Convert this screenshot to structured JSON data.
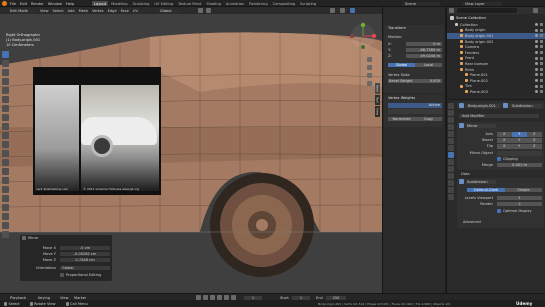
{
  "menubar": {
    "menus": [
      "File",
      "Edit",
      "Render",
      "Window",
      "Help"
    ],
    "workspaces": [
      "Layout",
      "Modeling",
      "Sculpting",
      "UV Editing",
      "Texture Paint",
      "Shading",
      "Animation",
      "Rendering",
      "Compositing",
      "Scripting"
    ],
    "scene": "Scene",
    "view_layer": "View Layer"
  },
  "header": {
    "mode": "Edit Mode",
    "menus": [
      "View",
      "Select",
      "Add",
      "Mesh",
      "Vertex",
      "Edge",
      "Face",
      "UV"
    ],
    "orientation": "Global"
  },
  "overlay": {
    "view_name": "Right Orthographic",
    "object_name": "(1) Body.origin.001",
    "units": "10 Centimeters"
  },
  "reference": {
    "left_caption": "car1 illustrations.com",
    "right_caption": "© 2011 Graeme Hollness www.gt.org"
  },
  "npanel": {
    "tabs": [
      "Item",
      "Tool",
      "View"
    ],
    "transform_header": "Transform",
    "median_label": "Median:",
    "x_label": "X:",
    "y_label": "Y:",
    "z_label": "Z:",
    "x_value": "0 m",
    "y_value": "-88.7584 m",
    "z_value": "49.0244 m",
    "global_button": "Global",
    "local_button": "Local",
    "vertex_data_header": "Vertex Data:",
    "bevel_weight_label": "Bevel Weight",
    "bevel_weight_value": "0.000",
    "vertex_weights_header": "Vertex Weights",
    "active_group_label": "Active",
    "vw_buttons": [
      "Normalize",
      "Copy"
    ]
  },
  "mirror_panel": {
    "header": "Mirror",
    "labels": [
      "Move X",
      "Move Y",
      "Move Z"
    ],
    "values": [
      "-0 cm",
      "-0.00282 cm",
      "0.7448 cm"
    ],
    "orientation_label": "Orientation",
    "orientation_value": "Global",
    "proportional": "Proportional Editing"
  },
  "outliner": {
    "title": "Scene Collection",
    "items": [
      {
        "label": "Collection",
        "depth": 1
      },
      {
        "label": "Body origin",
        "depth": 2
      },
      {
        "label": "Body origin.001",
        "depth": 2
      },
      {
        "label": "Body origin.002",
        "depth": 2
      },
      {
        "label": "Camera",
        "depth": 2
      },
      {
        "label": "Fenders",
        "depth": 2
      },
      {
        "label": "Front",
        "depth": 2
      },
      {
        "label": "Rear bumper",
        "depth": 2
      },
      {
        "label": "Rims",
        "depth": 2
      },
      {
        "label": "Plane.001",
        "depth": 3
      },
      {
        "label": "Plane.002",
        "depth": 3
      },
      {
        "label": "Tire",
        "depth": 2
      },
      {
        "label": "Plane.003",
        "depth": 3
      }
    ]
  },
  "properties": {
    "object_name": "Body.origin.001",
    "modifier_name": "Subdivision",
    "add_modifier": "Add Modifier",
    "mirror_header": "Mirror",
    "axis_label": "Axis",
    "bisect_label": "Bisect",
    "flip_label": "Flip",
    "axis_buttons": [
      "X",
      "Y",
      "Z"
    ],
    "mirror_object_label": "Mirror Object",
    "clipping_label": "Clipping",
    "merge_label": "Merge",
    "merge_value": "0.001 m",
    "data_label": "Data",
    "subdivision_header": "Subdivision",
    "catmull": "Catmull-Clark",
    "simple": "Simple",
    "levels_viewport_label": "Levels Viewport",
    "levels_viewport_value": "1",
    "render_label": "Render",
    "render_value": "2",
    "optimal_display": "Optimal Display",
    "advanced": "Advanced"
  },
  "timeline": {
    "playback": "Playback",
    "keying": "Keying",
    "view": "View",
    "marker": "Marker",
    "frame": "1",
    "start_label": "Start",
    "start": "1",
    "end_label": "End",
    "end": "250"
  },
  "statusbar": {
    "items": [
      "Select",
      "Rotate View",
      "Call Menu"
    ],
    "info": "Body.origin.001 | Verts 0/1,510 | Edges 0/3,001 | Faces 0/1,490 | Tris 2,968 | Objects 1/9"
  },
  "watermark": "Udemy",
  "colors": {
    "accent": "#4772b3",
    "clay": "#a47a62",
    "selected": "#3d5a8a",
    "bg": "#1d1d1d"
  }
}
